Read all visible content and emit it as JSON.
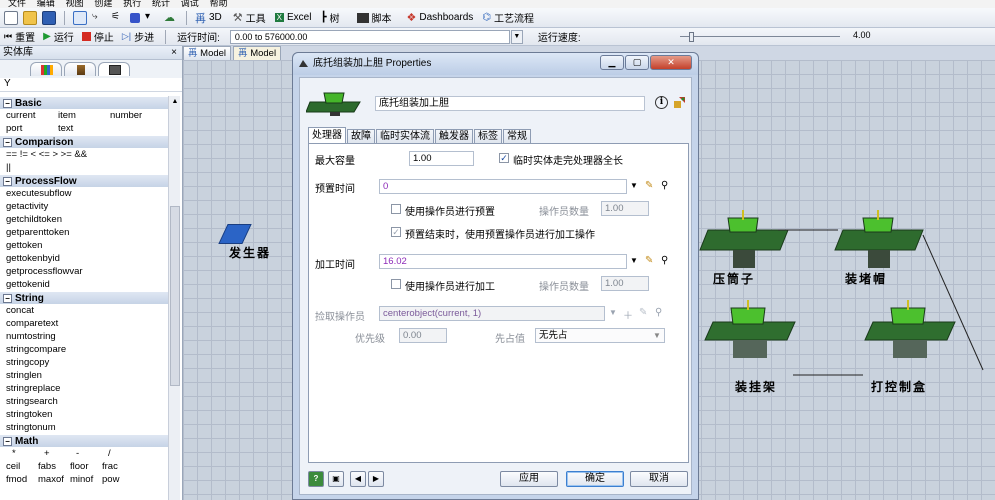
{
  "menubar": {
    "items": [
      "文件",
      "编辑",
      "视图",
      "创建",
      "执行",
      "统计",
      "调试",
      "帮助"
    ]
  },
  "toolbar": {
    "items": [
      {
        "label": "3D"
      },
      {
        "label": "工具"
      },
      {
        "label": "Excel"
      },
      {
        "label": "树"
      },
      {
        "label": "脚本"
      },
      {
        "label": "Dashboards"
      },
      {
        "label": "工艺流程"
      }
    ]
  },
  "runbar": {
    "reset": "重置",
    "run": "运行",
    "stop": "停止",
    "step": "步进",
    "runtime_label": "运行时间:",
    "runtime_value": "0.00  to  576000.00",
    "speed_label": "运行速度:",
    "speed_value": "4.00",
    "speed_fraction": 0.06
  },
  "library": {
    "title": "实体库",
    "close": "×",
    "filter": "Y",
    "categories": [
      {
        "name": "Basic",
        "rows": [
          [
            "current",
            "item",
            "number"
          ],
          [
            "port",
            "text",
            ""
          ]
        ]
      },
      {
        "name": "Comparison",
        "rows": [
          [
            "== != < <= > >= &&"
          ],
          [
            "||"
          ]
        ]
      },
      {
        "name": "ProcessFlow",
        "items": [
          "executesubflow",
          "getactivity",
          "getchildtoken",
          "getparenttoken",
          "gettoken",
          "gettokenbyid",
          "getprocessflowvar",
          "gettokenid"
        ]
      },
      {
        "name": "String",
        "items": [
          "concat",
          "comparetext",
          "numtostring",
          "stringcompare",
          "stringcopy",
          "stringlen",
          "stringreplace",
          "stringsearch",
          "stringtoken",
          "stringtonum"
        ]
      },
      {
        "name": "Math",
        "rows": [
          [
            "*",
            "+",
            "-",
            "/"
          ],
          [
            "ceil",
            "fabs",
            "floor",
            "frac"
          ],
          [
            "fmod",
            "maxof",
            "minof",
            "pow"
          ]
        ]
      }
    ]
  },
  "model": {
    "tabs": [
      "Model",
      "Model",
      "Model"
    ],
    "labels": {
      "generator": "发生器",
      "press": "压筒子",
      "cap": "装堵帽",
      "hang": "装挂架",
      "box": "打控制盒"
    }
  },
  "dialog": {
    "title": "底托组装加上胆  Properties",
    "object_name": "底托组装加上胆",
    "info": "i",
    "tabs": [
      "处理器",
      "故障",
      "临时实体流",
      "触发器",
      "标签",
      "常规"
    ],
    "max_capacity_label": "最大容量",
    "max_capacity": "1.00",
    "full_length_label": "临时实体走完处理器全长",
    "full_length_checked": true,
    "setup_time_label": "预置时间",
    "setup_time": "0",
    "use_operator_setup_label": "使用操作员进行预置",
    "use_operator_setup_checked": false,
    "operator_count_label": "操作员数量",
    "operator_count_setup": "1.00",
    "use_setup_operator_label": "预置结束时，使用预置操作员进行加工操作",
    "use_setup_operator_checked": true,
    "process_time_label": "加工时间",
    "process_time": "16.02",
    "use_operator_process_label": "使用操作员进行加工",
    "use_operator_process_checked": false,
    "operator_count_process": "1.00",
    "pick_operator_label": "捡取操作员",
    "pick_operator": "centerobject(current, 1)",
    "priority_label": "优先级",
    "priority": "0.00",
    "preempt_label": "先占值",
    "preempt": "无先占",
    "footer": {
      "apply": "应用",
      "ok": "确定",
      "cancel": "取消"
    }
  }
}
